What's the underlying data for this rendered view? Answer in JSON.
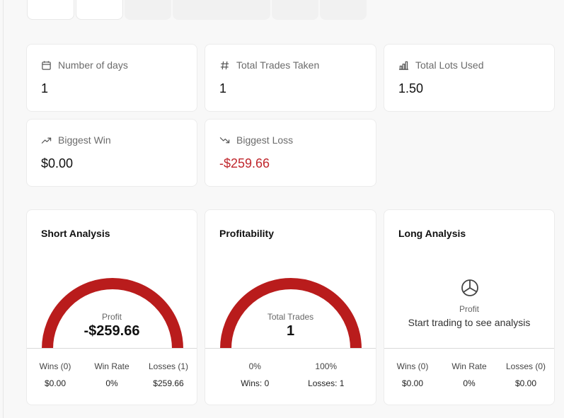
{
  "stats": {
    "days": {
      "label": "Number of days",
      "value": "1",
      "icon": "calendar-icon"
    },
    "trades": {
      "label": "Total Trades Taken",
      "value": "1",
      "icon": "hash-icon"
    },
    "lots": {
      "label": "Total Lots Used",
      "value": "1.50",
      "icon": "bar-chart-icon"
    },
    "win": {
      "label": "Biggest Win",
      "value": "$0.00",
      "icon": "trending-up-icon"
    },
    "loss": {
      "label": "Biggest Loss",
      "value": "-$259.66",
      "icon": "trending-down-icon"
    }
  },
  "short_analysis": {
    "title": "Short Analysis",
    "center_label": "Profit",
    "center_value": "-$259.66",
    "columns": [
      {
        "label": "Wins (0)",
        "value": "$0.00"
      },
      {
        "label": "Win Rate",
        "value": "0%"
      },
      {
        "label": "Losses (1)",
        "value": "$259.66"
      }
    ]
  },
  "profitability": {
    "title": "Profitability",
    "center_label": "Total Trades",
    "center_value": "1",
    "columns": [
      {
        "label": "0%",
        "value": "Wins: 0"
      },
      {
        "label": "100%",
        "value": "Losses: 1"
      }
    ]
  },
  "long_analysis": {
    "title": "Long Analysis",
    "empty_label": "Profit",
    "empty_message": "Start trading to see analysis",
    "columns": [
      {
        "label": "Wins (0)",
        "value": "$0.00"
      },
      {
        "label": "Win Rate",
        "value": "0%"
      },
      {
        "label": "Losses (0)",
        "value": "$0.00"
      }
    ]
  },
  "colors": {
    "loss": "#c0272d",
    "gauge": "#b91c1c"
  }
}
